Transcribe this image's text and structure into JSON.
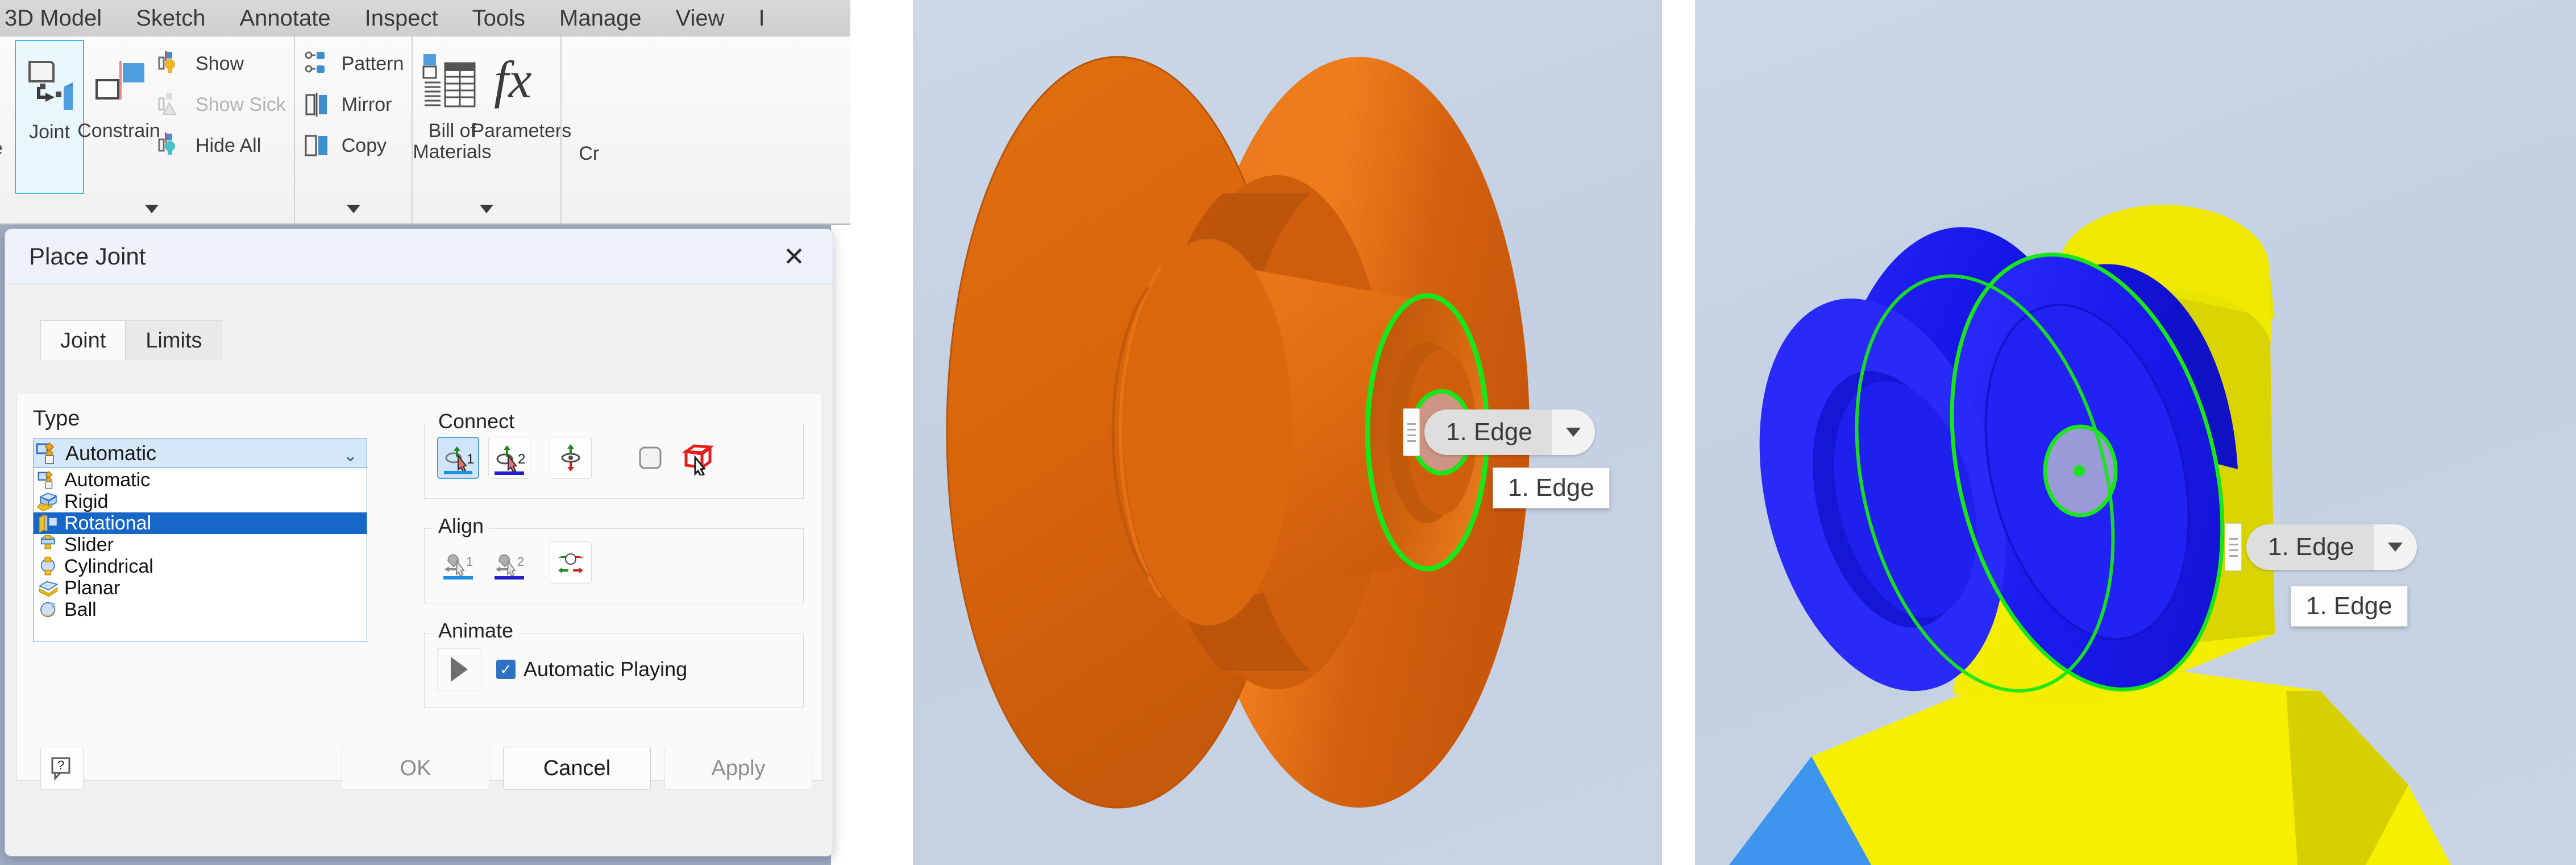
{
  "app": {
    "ribbon_tabs": [
      "3D Model",
      "Sketch",
      "Annotate",
      "Inspect",
      "Tools",
      "Manage",
      "View"
    ],
    "ribbon_tab_cut": "I",
    "left_partial_label": "e",
    "groups": [
      {
        "big_buttons": [
          {
            "label": "Joint",
            "icon": "joint-icon",
            "active": true
          },
          {
            "label": "Constrain",
            "icon": "constrain-icon",
            "active": false
          }
        ],
        "small_buttons": [
          {
            "label": "Show",
            "icon": "show-icon",
            "disabled": false
          },
          {
            "label": "Show Sick",
            "icon": "show-sick-icon",
            "disabled": true
          },
          {
            "label": "Hide All",
            "icon": "hide-all-icon",
            "disabled": false
          }
        ],
        "has_expander": true
      },
      {
        "small_buttons": [
          {
            "label": "Pattern",
            "icon": "pattern-icon",
            "disabled": false
          },
          {
            "label": "Mirror",
            "icon": "mirror-icon",
            "disabled": false
          },
          {
            "label": "Copy",
            "icon": "copy-icon",
            "disabled": false
          }
        ],
        "has_expander": true
      },
      {
        "big_buttons": [
          {
            "label": "Bill of Materials",
            "icon": "bill-of-materials-icon",
            "active": false
          },
          {
            "label": "Parameters",
            "icon": "parameters-fx-icon",
            "active": false
          }
        ],
        "has_expander": true
      },
      {
        "cut_label": "Cr"
      }
    ]
  },
  "dialog": {
    "title": "Place Joint",
    "close_icon": "close-icon",
    "tabs": [
      {
        "label": "Joint",
        "selected": true
      },
      {
        "label": "Limits",
        "selected": false
      }
    ],
    "type": {
      "label": "Type",
      "selected_value": "Automatic",
      "chevron_icon": "chevron-down-icon",
      "options": [
        {
          "label": "Automatic",
          "icon": "joint-automatic-icon",
          "selected": false
        },
        {
          "label": "Rigid",
          "icon": "joint-rigid-icon",
          "selected": false
        },
        {
          "label": "Rotational",
          "icon": "joint-rotational-icon",
          "selected": true
        },
        {
          "label": "Slider",
          "icon": "joint-slider-icon",
          "selected": false
        },
        {
          "label": "Cylindrical",
          "icon": "joint-cylindrical-icon",
          "selected": false
        },
        {
          "label": "Planar",
          "icon": "joint-planar-icon",
          "selected": false
        },
        {
          "label": "Ball",
          "icon": "joint-ball-icon",
          "selected": false
        }
      ]
    },
    "connect": {
      "label": "Connect",
      "buttons": [
        {
          "name": "pick-component-1-button",
          "badge": "1",
          "icon": "pick-component-1-icon",
          "active": true,
          "underline": "#1f8fe0"
        },
        {
          "name": "pick-component-2-button",
          "badge": "2",
          "icon": "pick-component-2-icon",
          "active": false,
          "underline": "#2020d0"
        },
        {
          "name": "flip-origin-button",
          "badge": "",
          "icon": "flip-origin-icon",
          "active": false,
          "underline": ""
        },
        {
          "name": "empty-slot",
          "badge": "",
          "icon": "rounded-square-icon",
          "active": false,
          "underline": ""
        },
        {
          "name": "transparent-component-button",
          "badge": "",
          "icon": "red-cube-cursor-icon",
          "active": false,
          "underline": ""
        }
      ]
    },
    "align": {
      "label": "Align",
      "buttons": [
        {
          "name": "align-1-button",
          "badge": "1",
          "icon": "align-1-icon",
          "active": false,
          "underline": "#1f8fe0"
        },
        {
          "name": "align-2-button",
          "badge": "2",
          "icon": "align-2-icon",
          "active": false,
          "underline": "#2020d0"
        },
        {
          "name": "flip-align-button",
          "badge": "",
          "icon": "flip-align-icon",
          "active": false,
          "underline": ""
        }
      ]
    },
    "animate": {
      "label": "Animate",
      "play_icon": "play-icon",
      "checkbox": {
        "label": "Automatic Playing",
        "checked": true
      }
    },
    "footer": {
      "help_icon": "help-icon",
      "ok_label": "OK",
      "cancel_label": "Cancel",
      "apply_label": "Apply"
    }
  },
  "viewports": [
    {
      "name": "orange-wheel-viewport",
      "model_color": "#e06a16",
      "highlight_color": "#22e022",
      "hud": {
        "value": "1. Edge",
        "dropdown_icon": "chevron-down-icon",
        "grip_icon": "drag-grip-icon"
      },
      "tooltip": "1. Edge"
    },
    {
      "name": "blue-yellow-assembly-viewport",
      "model_color": "#1a1aee",
      "body_color": "#f6f000",
      "highlight_color": "#22e022",
      "hud": {
        "value": "1. Edge",
        "dropdown_icon": "chevron-down-icon",
        "grip_icon": "drag-grip-icon"
      },
      "tooltip": "1. Edge"
    }
  ]
}
